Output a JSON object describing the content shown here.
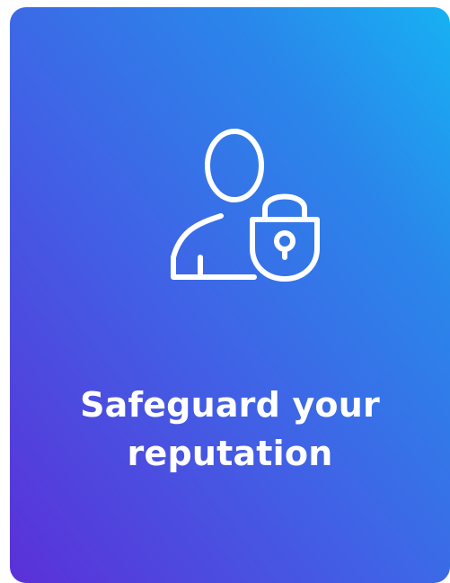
{
  "card": {
    "icon": "user-lock-icon",
    "title_line1": "Safeguard your",
    "title_line2": "reputation",
    "colors": {
      "gradient_start": "#5b30d8",
      "gradient_mid": "#3f64e6",
      "gradient_end": "#17b1f3",
      "text": "#ffffff"
    }
  }
}
